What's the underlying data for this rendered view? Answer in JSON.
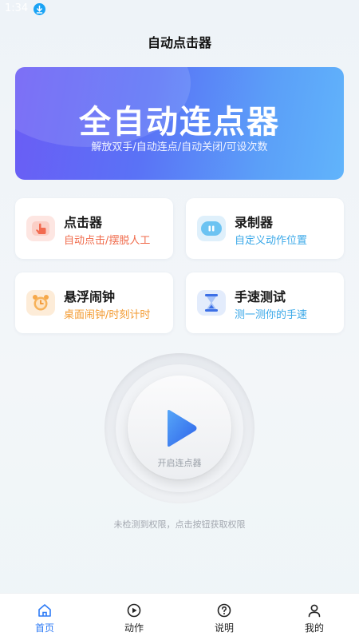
{
  "status_bar": {
    "time": "1:34"
  },
  "header": {
    "title": "自动点击器"
  },
  "banner": {
    "title": "全自动连点器",
    "subtitle": "解放双手/自动连点/自动关闭/可设次数"
  },
  "features": [
    {
      "title": "点击器",
      "subtitle": "自动点击/摆脱人工",
      "icon": "hand-tap-icon",
      "accent": "#f06a4a"
    },
    {
      "title": "录制器",
      "subtitle": "自定义动作位置",
      "icon": "record-icon",
      "accent": "#3aa8e8"
    },
    {
      "title": "悬浮闹钟",
      "subtitle": "桌面闹钟/时刻计时",
      "icon": "alarm-clock-icon",
      "accent": "#f39a30"
    },
    {
      "title": "手速测试",
      "subtitle": "测一测你的手速",
      "icon": "hourglass-icon",
      "accent": "#3aa8e8"
    }
  ],
  "start": {
    "label": "开启连点器"
  },
  "permission_hint": "未检测到权限，点击按钮获取权限",
  "tabs": [
    {
      "label": "首页",
      "icon": "home-icon",
      "active": true
    },
    {
      "label": "动作",
      "icon": "play-circle-icon",
      "active": false
    },
    {
      "label": "说明",
      "icon": "help-circle-icon",
      "active": false
    },
    {
      "label": "我的",
      "icon": "user-icon",
      "active": false
    }
  ],
  "colors": {
    "accent": "#2f7cf6",
    "banner_start": "#6b5cf5",
    "banner_end": "#61b4fb",
    "play": "#3b7cf0"
  }
}
